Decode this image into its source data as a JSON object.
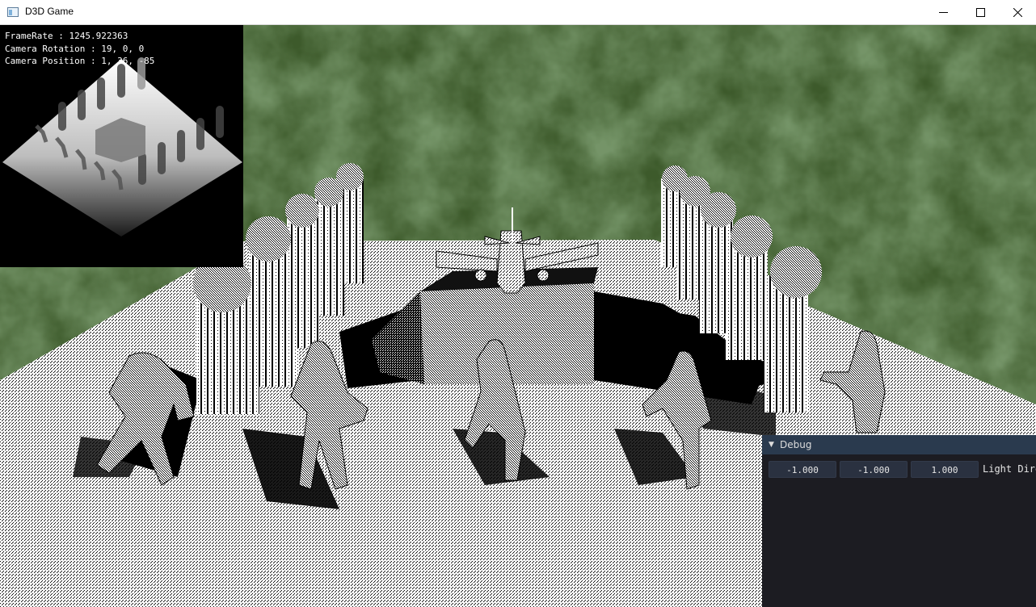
{
  "window": {
    "title": "D3D Game",
    "icon": "app-window-icon",
    "controls": [
      "minimize-icon",
      "maximize-icon",
      "close-icon"
    ]
  },
  "hud": {
    "framerate": "FrameRate : 1245.922363",
    "camera_rotation": "Camera Rotation : 19, 0, 0",
    "camera_position": "Camera Position : 1, 36, -85"
  },
  "debug_panel": {
    "title": "Debug",
    "collapse_icon": "triangle-down-icon",
    "light_direction": {
      "label": "Light Dire",
      "x": "-1.000",
      "y": "-1.000",
      "z": "1.000"
    }
  },
  "colors": {
    "grass": "#3e5a2c",
    "panel_bg": "#1c1c22",
    "panel_header": "#2a3a4e",
    "field_bg": "#2a3140"
  }
}
